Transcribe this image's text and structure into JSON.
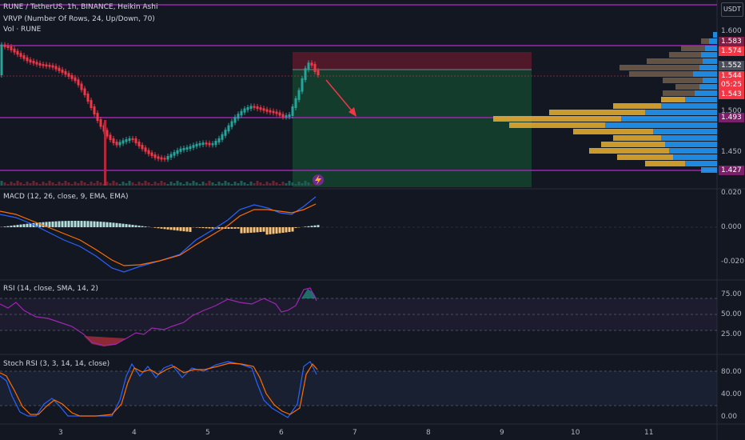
{
  "header": {
    "symbol_line": "RUNE / TetherUS, 1h, BINANCE, Heikin Ashi",
    "vrvp_line": "VRVP (Number Of Rows, 24, Up/Down, 70)",
    "vol_line": "Vol · RUNE"
  },
  "currency": "USDT",
  "price_axis": [
    "1.600",
    "1.500",
    "1.450"
  ],
  "price_tags": [
    {
      "text": "1.583",
      "color": "#7b1f45"
    },
    {
      "text": "1.574",
      "color": "#f23645"
    },
    {
      "text": "1.552",
      "color": "#4a4e5a"
    },
    {
      "text": "1.544",
      "color": "#f23645"
    },
    {
      "text": "05:25",
      "color": "#f23645"
    },
    {
      "text": "1.543",
      "color": "#f23645"
    },
    {
      "text": "1.493",
      "color": "#7b1f6a"
    },
    {
      "text": "1.427",
      "color": "#7b1f6a"
    }
  ],
  "macd": {
    "title": "MACD (12, 26, close, 9, EMA, EMA)",
    "axis": [
      "0.020",
      "0.000",
      "-0.020"
    ]
  },
  "rsi": {
    "title": "RSI (14, close, SMA, 14, 2)",
    "axis": [
      "75.00",
      "50.00",
      "25.00"
    ]
  },
  "stoch": {
    "title": "Stoch RSI (3, 3, 14, 14, close)",
    "axis": [
      "80.00",
      "40.00",
      "0.00"
    ]
  },
  "x_axis": [
    "3",
    "4",
    "5",
    "6",
    "7",
    "8",
    "9",
    "10",
    "11"
  ],
  "colors": {
    "bg": "#131722",
    "up": "#26a69a",
    "down": "#f23645",
    "level_line": "#9c27b0",
    "macd_line": "#2962ff",
    "signal_line": "#ff6d00",
    "rsi_line": "#7e57c2",
    "vrvp_up": "#2196f3",
    "vrvp_down": "#e0a82e"
  },
  "icons": {
    "lightning": "lightning-icon"
  }
}
